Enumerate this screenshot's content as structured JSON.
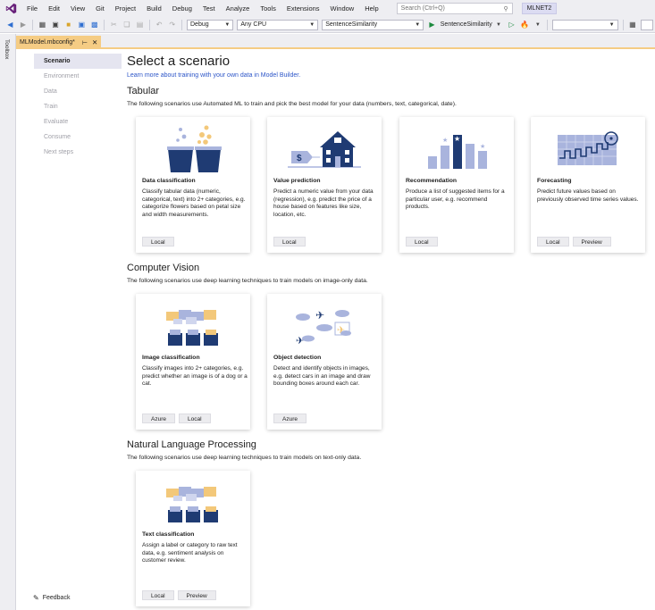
{
  "menu": {
    "items": [
      "File",
      "Edit",
      "View",
      "Git",
      "Project",
      "Build",
      "Debug",
      "Test",
      "Analyze",
      "Tools",
      "Extensions",
      "Window",
      "Help"
    ],
    "search_placeholder": "Search (Ctrl+Q)",
    "solution_name": "MLNET2"
  },
  "toolbar": {
    "config": "Debug",
    "platform": "Any CPU",
    "project": "SentenceSimilarity",
    "start_label": "SentenceSimilarity"
  },
  "toolbox_label": "Toolbox",
  "document_tab": {
    "title": "MLModel.mbconfig*",
    "pin_icon": "pin-icon",
    "close_icon": "close-icon"
  },
  "nav": {
    "items": [
      {
        "label": "Scenario",
        "active": true
      },
      {
        "label": "Environment",
        "active": false
      },
      {
        "label": "Data",
        "active": false
      },
      {
        "label": "Train",
        "active": false
      },
      {
        "label": "Evaluate",
        "active": false
      },
      {
        "label": "Consume",
        "active": false
      },
      {
        "label": "Next steps",
        "active": false
      }
    ],
    "feedback": "Feedback"
  },
  "main": {
    "title": "Select a scenario",
    "learn_link": "Learn more about training with your own data in Model Builder.",
    "sections": [
      {
        "title": "Tabular",
        "description": "The following scenarios use Automated ML to train and pick the best model for your data (numbers, text, categorical, date).",
        "cards": [
          {
            "title": "Data classification",
            "description": "Classify tabular data (numeric, categorical, text) into 2+ categories, e.g. categorize flowers based on petal size and width measurements.",
            "tags": [
              "Local"
            ],
            "icon": "buckets-icon"
          },
          {
            "title": "Value prediction",
            "description": "Predict a numeric value from your data (regression), e.g. predict the price of a house based on features like size, location, etc.",
            "tags": [
              "Local"
            ],
            "icon": "house-price-icon"
          },
          {
            "title": "Recommendation",
            "description": "Produce a list of suggested items for a particular user, e.g. recommend products.",
            "tags": [
              "Local"
            ],
            "icon": "bar-stars-icon"
          },
          {
            "title": "Forecasting",
            "description": "Predict future values based on previously observed time series values.",
            "tags": [
              "Local",
              "Preview"
            ],
            "icon": "timeseries-icon"
          }
        ]
      },
      {
        "title": "Computer Vision",
        "description": "The following scenarios use deep learning techniques to train models on image-only data.",
        "cards": [
          {
            "title": "Image classification",
            "description": "Classify images into 2+ categories, e.g. predict whether an image is of a dog or a cat.",
            "tags": [
              "Azure",
              "Local"
            ],
            "icon": "image-folders-icon"
          },
          {
            "title": "Object detection",
            "description": "Detect and identify objects in images, e.g. detect cars in an image and draw bounding boxes around each car.",
            "tags": [
              "Azure"
            ],
            "icon": "planes-clouds-icon"
          }
        ]
      },
      {
        "title": "Natural Language Processing",
        "description": "The following scenarios use deep learning techniques to train models on text-only data.",
        "cards": [
          {
            "title": "Text classification",
            "description": "Assign a label or category to raw text data, e.g. sentiment analysis on customer review.",
            "tags": [
              "Local",
              "Preview"
            ],
            "icon": "text-folders-icon"
          }
        ]
      }
    ]
  },
  "colors": {
    "accent_tab": "#f5cc84",
    "navy": "#1f3b73",
    "light_blue": "#a9b4dd",
    "link": "#2c55c8"
  }
}
